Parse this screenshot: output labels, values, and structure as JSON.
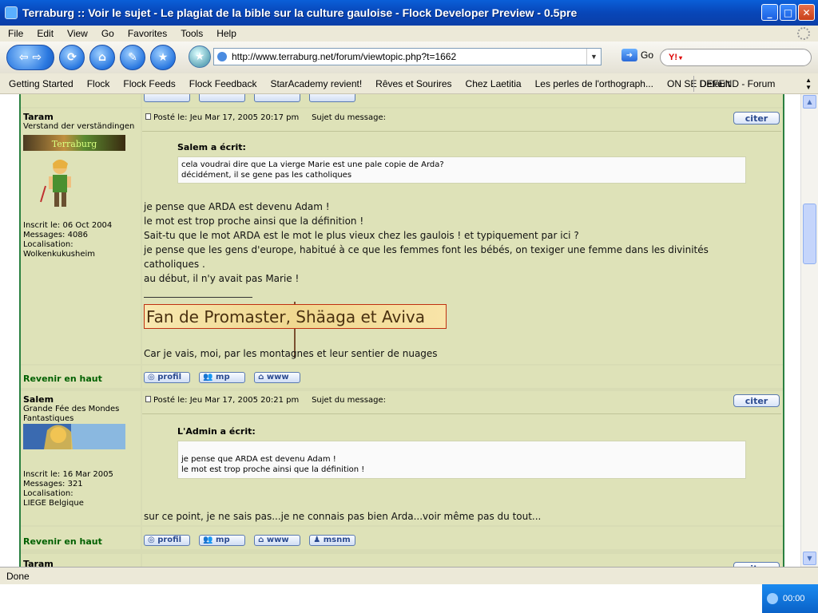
{
  "window": {
    "title": "Terraburg :: Voir le sujet - Le plagiat de la bible sur la culture gauloise - Flock Developer Preview - 0.5pre",
    "min_glyph": "_",
    "max_glyph": "□",
    "close_glyph": "✕"
  },
  "menu": [
    "File",
    "Edit",
    "View",
    "Go",
    "Favorites",
    "Tools",
    "Help"
  ],
  "nav": {
    "url": "http://www.terraburg.net/forum/viewtopic.php?t=1662",
    "go_label": "Go",
    "search_logo": "Y!"
  },
  "bookmarks": {
    "items": [
      "Getting Started",
      "Flock",
      "Flock Feeds",
      "Flock Feedback",
      "StarAcademy revient!",
      "Rêves et Sourires",
      "Chez Laetitia",
      "Les perles de l'orthograph...",
      "ON SE DEFEND - Forum"
    ],
    "selector": "Default"
  },
  "post1": {
    "author": "Taram",
    "rank": "Verstand der verständingen",
    "rank_image_text": "Terraburg",
    "joined": "Inscrit le: 06 Oct 2004",
    "messages": "Messages: 4086",
    "location_label": "Localisation:",
    "location": "Wolkenkukusheim",
    "header": "Posté le: Jeu Mar 17, 2005 20:17 pm     Sujet du message:",
    "quote_author": "Salem a écrit:",
    "quote_lines": [
      "cela voudrai dire que La vierge Marie est une pale copie de Arda?",
      "décidément, il se gene pas les catholiques"
    ],
    "body_lines": [
      "je pense que ARDA est devenu Adam !",
      "le mot est trop proche ainsi que la définition !",
      "Sait-tu que le mot ARDA est le mot le plus vieux chez les gaulois ! et typiquement par ici ?",
      "je pense que les gens d'europe, habitué à ce que les femmes font les bébés, on texiger une femme dans les divinités",
      "catholiques .",
      "au début, il n'y avait pas Marie !"
    ],
    "signature_banner": "Fan de Promaster, Shäaga et Aviva",
    "signature_line": "Car je vais, moi, par les montagnes et leur sentier de nuages",
    "back_label": "Revenir en haut",
    "buttons": [
      "profil",
      "mp",
      "www"
    ]
  },
  "post2": {
    "author": "Salem",
    "rank": "Grande Fée des Mondes Fantastiques",
    "joined": "Inscrit le: 16 Mar 2005",
    "messages": "Messages: 321",
    "location_label": "Localisation:",
    "location": "LIEGE Belgique",
    "header": "Posté le: Jeu Mar 17, 2005 20:21 pm     Sujet du message:",
    "quote_author": "L'Admin a écrit:",
    "quote_lines": [
      "je pense que ARDA est devenu Adam !",
      "le mot est trop proche ainsi que la définition !"
    ],
    "body_line": "sur ce point, je ne sais pas...je ne connais pas bien Arda...voir même pas du tout...",
    "back_label": "Revenir en haut",
    "buttons": [
      "profil",
      "mp",
      "www",
      "msnm"
    ]
  },
  "post3": {
    "author": "Taram"
  },
  "citer_label": "citer",
  "status": {
    "text": "Done",
    "clock": "00:00"
  },
  "colors": {
    "title_blue": "#0846b8",
    "forum_bg": "#dee2b8",
    "back_green": "#006000",
    "button_blue": "#2a4a90"
  }
}
